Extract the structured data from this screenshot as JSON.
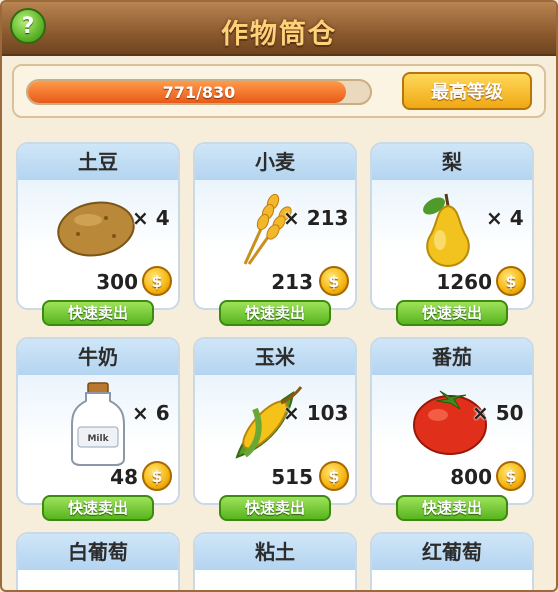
{
  "header": {
    "title": "作物筒仓",
    "help_icon": "?"
  },
  "capacity": {
    "text": "771/830",
    "used": 771,
    "max": 830,
    "max_button": "最高等级"
  },
  "crops": [
    {
      "name": "土豆",
      "qty": "× 4",
      "price": "300",
      "sell": "快速卖出",
      "icon": "potato-icon"
    },
    {
      "name": "小麦",
      "qty": "× 213",
      "price": "213",
      "sell": "快速卖出",
      "icon": "wheat-icon"
    },
    {
      "name": "梨",
      "qty": "× 4",
      "price": "1260",
      "sell": "快速卖出",
      "icon": "pear-icon"
    },
    {
      "name": "牛奶",
      "qty": "× 6",
      "price": "48",
      "sell": "快速卖出",
      "icon": "milk-bottle-icon",
      "label": "Milk"
    },
    {
      "name": "玉米",
      "qty": "× 103",
      "price": "515",
      "sell": "快速卖出",
      "icon": "corn-icon"
    },
    {
      "name": "番茄",
      "qty": "× 50",
      "price": "800",
      "sell": "快速卖出",
      "icon": "tomato-icon"
    }
  ],
  "next_row": [
    {
      "name": "白葡萄"
    },
    {
      "name": "粘土"
    },
    {
      "name": "红葡萄"
    }
  ],
  "coin_symbol": "$",
  "colors": {
    "header": "#8b5a2e",
    "progress": "#e85a18",
    "sell": "#58b51f",
    "coin": "#f5b50f"
  }
}
